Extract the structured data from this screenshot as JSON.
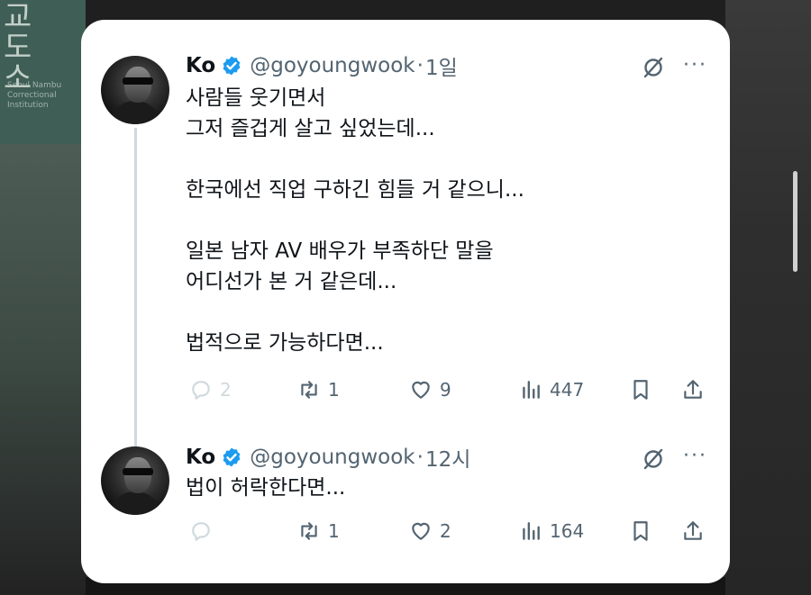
{
  "background": {
    "sign_big": "교\n도\n소",
    "sign_small": "Seoul Nambu\nCorrectional\nInstitution"
  },
  "colors": {
    "text": "#0f1419",
    "secondary": "#536471",
    "verified": "#1d9bf0",
    "card": "#ffffff"
  },
  "tweets": [
    {
      "name": "Ko",
      "handle": "@goyoungwook",
      "dot": "·",
      "time": "1일",
      "lines": [
        "사람들 웃기면서",
        "그저 즐겁게 살고 싶었는데...",
        "",
        "한국에선 직업 구하긴 힘들 거 같으니...",
        "",
        "일본 남자 AV 배우가 부족하단 말을",
        "어디선가 본 거 같은데...",
        "",
        "법적으로 가능하다면..."
      ],
      "replies": "2",
      "retweets": "1",
      "likes": "9",
      "views": "447",
      "icons": [
        "grok-icon",
        "more-icon",
        "reply-icon",
        "retweet-icon",
        "like-icon",
        "views-icon",
        "bookmark-icon",
        "share-icon"
      ]
    },
    {
      "name": "Ko",
      "handle": "@goyoungwook",
      "dot": "·",
      "time": "12시",
      "lines": [
        "법이 허락한다면..."
      ],
      "replies": "",
      "retweets": "1",
      "likes": "2",
      "views": "164"
    }
  ]
}
